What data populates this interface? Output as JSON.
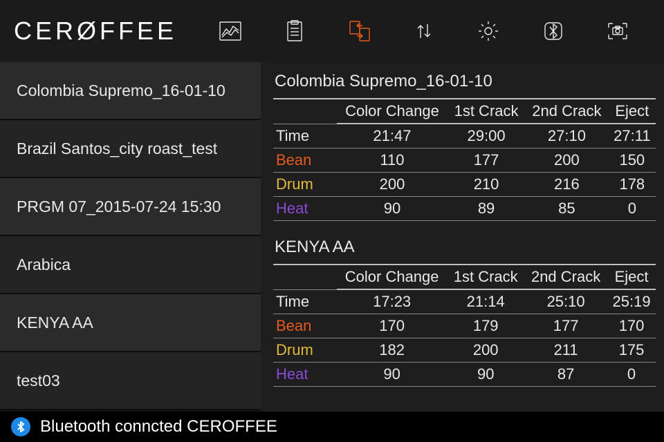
{
  "logo_text": "CERØFFEE",
  "toolbar": {
    "chart": "chart-icon",
    "clipboard": "clipboard-icon",
    "transfer": "transfer-icon",
    "sync": "sync-icon",
    "settings": "settings-icon",
    "bluetooth": "bluetooth-icon",
    "camera": "camera-icon"
  },
  "sidebar": {
    "items": [
      {
        "label": "Colombia Supremo_16-01-10"
      },
      {
        "label": "Brazil Santos_city roast_test"
      },
      {
        "label": "PRGM 07_2015-07-24 15:30"
      },
      {
        "label": "Arabica"
      },
      {
        "label": "KENYA AA"
      },
      {
        "label": "test03"
      }
    ]
  },
  "columns": [
    "Color Change",
    "1st Crack",
    "2nd Crack",
    "Eject"
  ],
  "row_labels": {
    "time": "Time",
    "bean": "Bean",
    "drum": "Drum",
    "heat": "Heat"
  },
  "panels": [
    {
      "title": "Colombia Supremo_16-01-10",
      "rows": {
        "time": [
          "21:47",
          "29:00",
          "27:10",
          "27:11"
        ],
        "bean": [
          "110",
          "177",
          "200",
          "150"
        ],
        "drum": [
          "200",
          "210",
          "216",
          "178"
        ],
        "heat": [
          "90",
          "89",
          "85",
          "0"
        ]
      }
    },
    {
      "title": "KENYA AA",
      "rows": {
        "time": [
          "17:23",
          "21:14",
          "25:10",
          "25:19"
        ],
        "bean": [
          "170",
          "179",
          "177",
          "170"
        ],
        "drum": [
          "182",
          "200",
          "211",
          "175"
        ],
        "heat": [
          "90",
          "90",
          "87",
          "0"
        ]
      }
    }
  ],
  "footer": {
    "status": "Bluetooth conncted CEROFFEE"
  },
  "colors": {
    "accent_active": "#e65a1c",
    "bean": "#e65a1c",
    "drum": "#e2b93b",
    "heat": "#8a4ad6",
    "bt": "#1e88e5"
  }
}
